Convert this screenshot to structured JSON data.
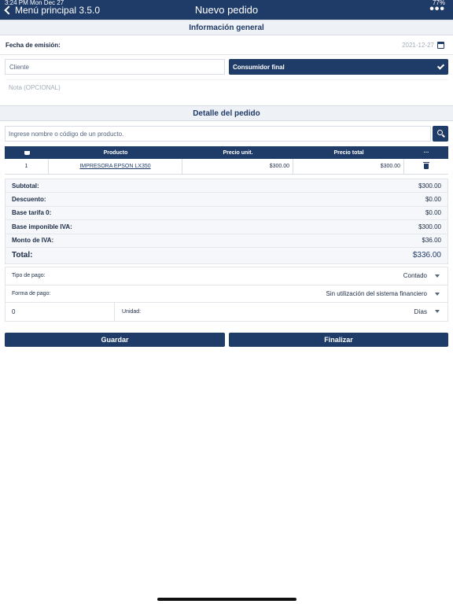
{
  "status_bar": {
    "left": "3:24 PM  Mon Dec 27",
    "right": "77%"
  },
  "navbar": {
    "back_label": "Menú principal 3.5.0",
    "title": "Nuevo pedido",
    "more": "•••"
  },
  "general": {
    "header": "Información general",
    "fecha_label": "Fecha de emisión:",
    "fecha_value": "2021-12-27",
    "cliente_placeholder": "Cliente",
    "consumidor_label": "Consumidor final",
    "nota_placeholder": "Nota (OPCIONAL)"
  },
  "detalle": {
    "header": "Detalle del pedido",
    "search_placeholder": "Ingrese nombre o código de un producto.",
    "columns": [
      "Producto",
      "Precio unit.",
      "Precio total",
      "···"
    ],
    "rows": [
      {
        "qty": "1",
        "product": "IMPRESORA EPSON LX350",
        "unit_price": "$300.00",
        "total_price": "$300.00"
      }
    ]
  },
  "totals": [
    {
      "label": "Subtotal:",
      "value": "$300.00"
    },
    {
      "label": "Descuento:",
      "value": "$0.00"
    },
    {
      "label": "Base tarifa 0:",
      "value": "$0.00"
    },
    {
      "label": "Base imponible IVA:",
      "value": "$300.00"
    },
    {
      "label": "Monto de IVA:",
      "value": "$36.00"
    }
  ],
  "grand_total": {
    "label": "Total:",
    "value": "$336.00"
  },
  "payment": {
    "tipo_label": "Tipo de pago:",
    "tipo_value": "Contado",
    "forma_label": "Forma de pago:",
    "forma_value": "Sin utilización del sistema financiero",
    "plazo_value": "0",
    "unidad_label": "Unidad:",
    "unidad_value": "Días"
  },
  "actions": {
    "save": "Guardar",
    "finish": "Finalizar"
  },
  "colors": {
    "primary": "#1f3b68",
    "section_bg": "#eef1f5"
  }
}
